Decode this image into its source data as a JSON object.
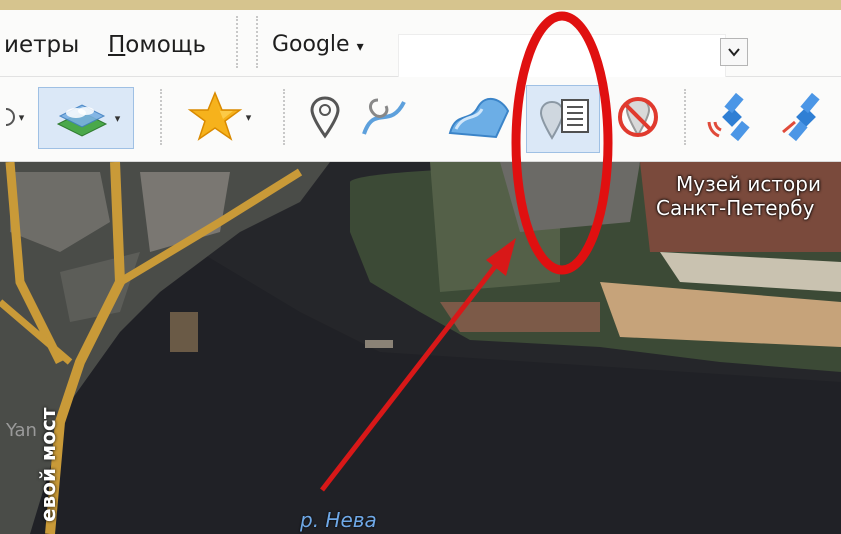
{
  "menubar": {
    "params_label": "иетры",
    "help_label_first": "П",
    "help_label_rest": "омощь"
  },
  "search": {
    "engine_label": "Google",
    "engine_arrow": "▾",
    "value": "",
    "dropdown_glyph": "⌄"
  },
  "toolbar": {
    "dropdown_arrow": "▾",
    "buttons": [
      {
        "name": "layers-icon",
        "state": "active"
      },
      {
        "name": "favorites-star-icon",
        "state": "normal"
      },
      {
        "name": "placemark-icon",
        "state": "normal"
      },
      {
        "name": "path-icon",
        "state": "normal"
      },
      {
        "name": "polygon-icon",
        "state": "normal"
      },
      {
        "name": "placemark-list-icon",
        "state": "active"
      },
      {
        "name": "no-placemark-icon",
        "state": "normal"
      },
      {
        "name": "satellite-signal-icon",
        "state": "normal"
      },
      {
        "name": "satellite-icon",
        "state": "normal"
      }
    ]
  },
  "map": {
    "museum_line1": "Музей истори",
    "museum_line2": "Санкт-Петербу",
    "river_label": "р. Нева",
    "bridge_label": "евой мост",
    "watermark": "Yan"
  },
  "colors": {
    "highlight_ring": "#e01010",
    "arrow": "#d81818",
    "active_button": "#dbe8f7"
  }
}
